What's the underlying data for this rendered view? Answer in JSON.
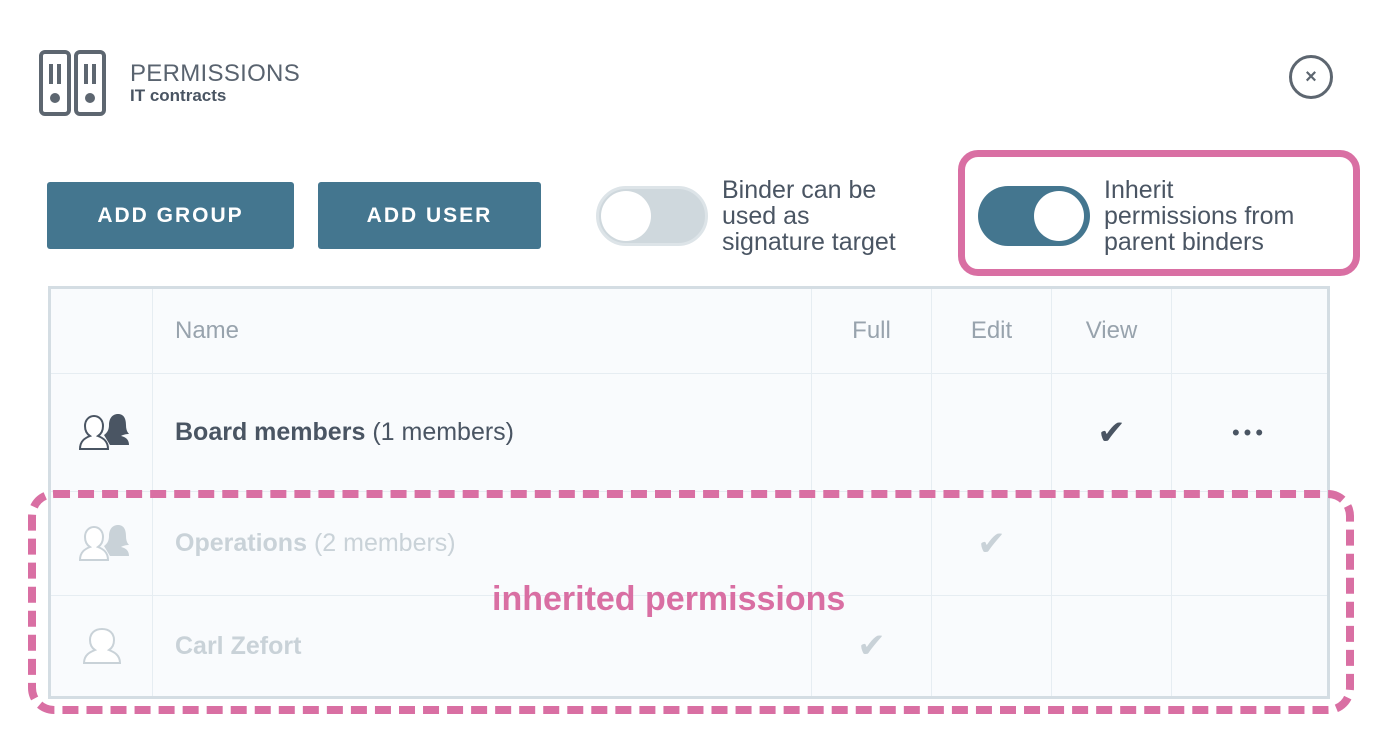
{
  "header": {
    "title": "PERMISSIONS",
    "subtitle": "IT contracts",
    "icon": "binders-icon",
    "close_icon": "×"
  },
  "toolbar": {
    "add_group": "ADD GROUP",
    "add_user": "ADD USER",
    "signature_toggle": {
      "label_lines": [
        "Binder can be",
        "used as",
        "signature target"
      ],
      "on": false
    },
    "inherit_toggle": {
      "label_lines": [
        "Inherit",
        "permissions from",
        "parent binders"
      ],
      "on": true
    }
  },
  "table": {
    "columns": [
      "Name",
      "Full",
      "Edit",
      "View"
    ],
    "rows": [
      {
        "name": "Board members",
        "count": "(1 members)",
        "type": "group",
        "permission": "View",
        "inherited": false,
        "more": "•••"
      },
      {
        "name": "Operations",
        "count": "(2 members)",
        "type": "group",
        "permission": "Edit",
        "inherited": true
      },
      {
        "name": "Carl Zefort",
        "count": "",
        "type": "user",
        "permission": "Full",
        "inherited": true
      }
    ]
  },
  "annotation": {
    "text": "inherited permissions"
  },
  "colors": {
    "accent": "#44768f",
    "highlight": "#d96fa3",
    "dark": "#4a5563",
    "dim": "#c9d2d8"
  }
}
